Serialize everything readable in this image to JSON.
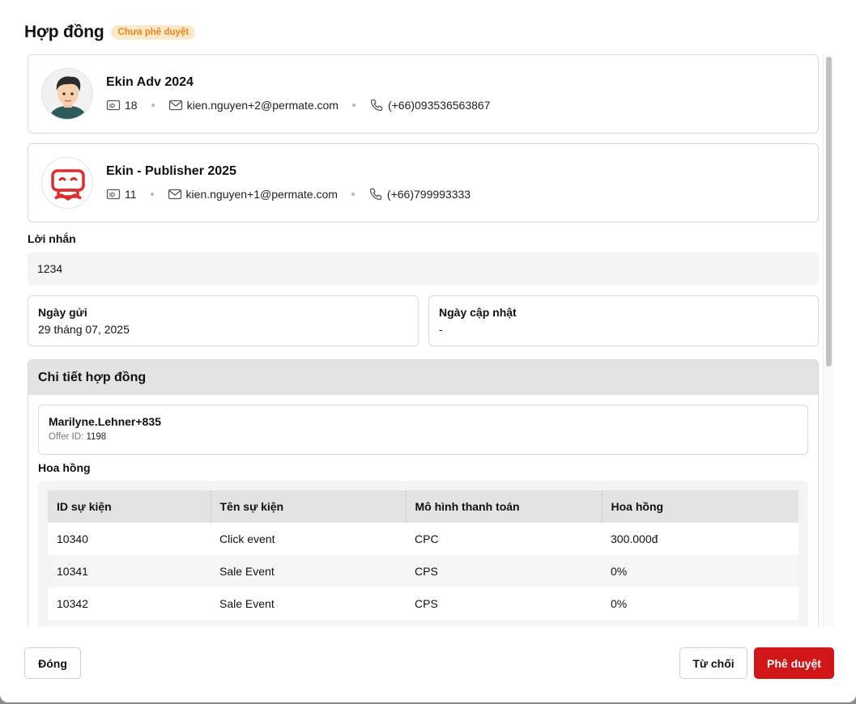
{
  "header": {
    "title": "Hợp đồng",
    "status_badge": "Chưa phê duyệt"
  },
  "colors": {
    "accent": "#d1161a",
    "badge_bg": "#fde8c8",
    "badge_text": "#e8861f"
  },
  "advertiser": {
    "name": "Ekin Adv 2024",
    "id": "18",
    "email": "kien.nguyen+2@permate.com",
    "phone": "(+66)093536563867"
  },
  "publisher": {
    "name": "Ekin - Publisher 2025",
    "id": "11",
    "email": "kien.nguyen+1@permate.com",
    "phone": "(+66)799993333"
  },
  "message": {
    "label": "Lời nhắn",
    "value": "1234"
  },
  "dates": {
    "sent_label": "Ngày gửi",
    "sent_value": "29 tháng 07, 2025",
    "updated_label": "Ngày cập nhật",
    "updated_value": "-"
  },
  "detail": {
    "title": "Chi tiết hợp đồng",
    "offer_name": "Marilyne.Lehner+835",
    "offer_id_label": "Offer ID:",
    "offer_id": "1198",
    "commission_label": "Hoa hồng",
    "table": {
      "headers": [
        "ID sự kiện",
        "Tên sự kiện",
        "Mô hình thanh toán",
        "Hoa hồng"
      ],
      "rows": [
        [
          "10340",
          "Click event",
          "CPC",
          "300.000đ"
        ],
        [
          "10341",
          "Sale Event",
          "CPS",
          "0%"
        ],
        [
          "10342",
          "Sale Event",
          "CPS",
          "0%"
        ],
        [
          "",
          "",
          "",
          ""
        ]
      ]
    }
  },
  "footer": {
    "close_label": "Đóng",
    "reject_label": "Từ chối",
    "approve_label": "Phê duyệt"
  },
  "icons": [
    "id-icon",
    "mail-icon",
    "phone-icon",
    "avatar-person",
    "robot-logo"
  ]
}
